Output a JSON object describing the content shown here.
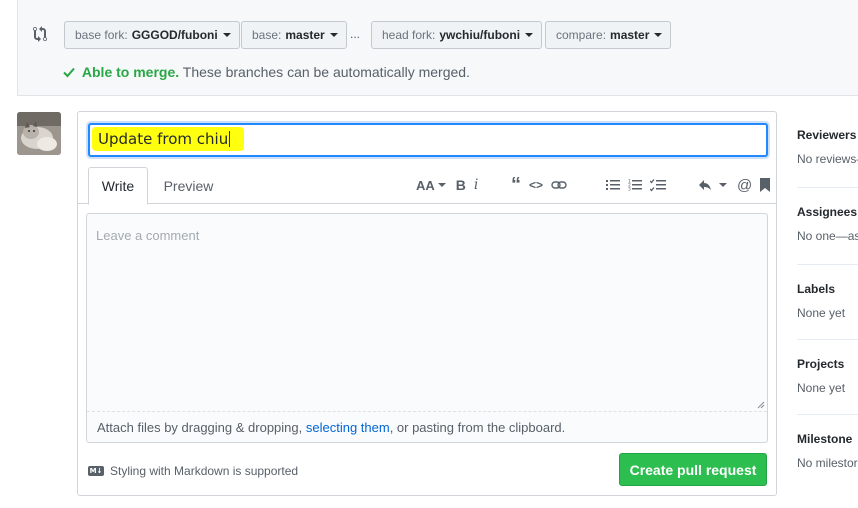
{
  "compare": {
    "base_fork_label": "base fork:",
    "base_fork_value": "GGGOD/fuboni",
    "base_label": "base:",
    "base_value": "master",
    "ellipsis": "...",
    "head_fork_label": "head fork:",
    "head_fork_value": "ywchiu/fuboni",
    "compare_label": "compare:",
    "compare_value": "master",
    "merge_status": "Able to merge.",
    "merge_message": "These branches can be automatically merged."
  },
  "form": {
    "title_value": "Update from chiu",
    "tabs": [
      {
        "label": "Write"
      },
      {
        "label": "Preview"
      }
    ],
    "toolbar": {
      "heading": "AA",
      "bold": "B",
      "italic": "i",
      "quote": "“",
      "code": "<>",
      "mention": "@"
    },
    "comment_placeholder": "Leave a comment",
    "attach_prefix": "Attach files by dragging & dropping, ",
    "attach_link": "selecting them",
    "attach_suffix": ", or pasting from the clipboard.",
    "markdown_note": "Styling with Markdown is supported",
    "markdown_icon_text": "M↓",
    "create_button": "Create pull request"
  },
  "sidebar": {
    "sections": [
      {
        "title": "Reviewers",
        "value": "No reviews—"
      },
      {
        "title": "Assignees",
        "value": "No one—as"
      },
      {
        "title": "Labels",
        "value": "None yet"
      },
      {
        "title": "Projects",
        "value": "None yet"
      },
      {
        "title": "Milestone",
        "value": "No milestor"
      }
    ]
  },
  "colors": {
    "accent_green": "#2cbe4e",
    "merge_green": "#28a745",
    "link_blue": "#0366d6",
    "focus_blue": "#2188ff",
    "highlight_yellow": "#ffff0f"
  }
}
